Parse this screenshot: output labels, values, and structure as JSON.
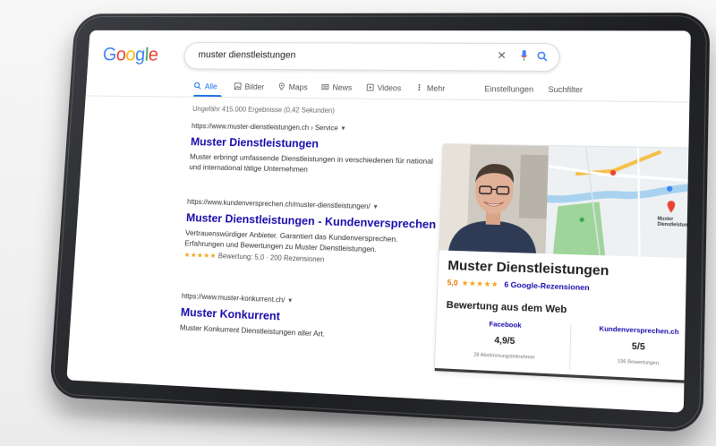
{
  "logo": [
    "G",
    "o",
    "o",
    "g",
    "l",
    "e"
  ],
  "search": {
    "query": "muster dienstleistungen"
  },
  "tabs": [
    {
      "label": "Alle",
      "icon": "search-icon"
    },
    {
      "label": "Bilder",
      "icon": "image-icon"
    },
    {
      "label": "Maps",
      "icon": "map-pin-icon"
    },
    {
      "label": "News",
      "icon": "news-icon"
    },
    {
      "label": "Videos",
      "icon": "video-icon"
    },
    {
      "label": "Mehr",
      "icon": "more-icon"
    }
  ],
  "tools": {
    "settings": "Einstellungen",
    "search_filter": "Suchfilter"
  },
  "stats": "Ungefähr 415.000 Ergebnisse (0,42 Sekunden)",
  "results": [
    {
      "url": "https://www.muster-dienstleistungen.ch › Service",
      "title": "Muster Dienstleistungen",
      "snippet": "Muster erbringt umfassende Dienstleistungen in verschiedenen für national und international tätige Unternehmen"
    },
    {
      "url": "https://www.kundenversprechen.ch/muster-dienstleistungen/",
      "title": "Muster Dienstleistungen - Kundenversprechen",
      "snippet": "Vertrauenswürdiger Anbieter. Garantiert das Kundenversprechen. Erfahrungen und Bewertungen zu Muster Dienstleistungen.",
      "stars": "★★★★★",
      "rating": "Bewertung: 5,0 · 200 Rezensionen"
    },
    {
      "url": "https://www.muster-konkurrent.ch/",
      "title": "Muster Konkurrent",
      "snippet": "Muster Konkurrent Dienstleistungen aller Art."
    }
  ],
  "panel": {
    "title": "Muster Dienstleistungen",
    "rating_value": "5,0",
    "stars": "★★★★★",
    "reviews_link": "6 Google-Rezensionen",
    "section": "Bewertung aus dem Web",
    "map_label": "Muster Dienstleistungen",
    "web_ratings": [
      {
        "source": "Facebook",
        "score": "4,9/5",
        "count": "28 Abstimmungsteilnehmer"
      },
      {
        "source": "Kundenversprechen.ch",
        "score": "5/5",
        "count": "196 Bewertungen"
      }
    ]
  },
  "colors": {
    "link": "#1a0dab",
    "accent": "#1a73e8",
    "stars": "#f4a31c"
  }
}
